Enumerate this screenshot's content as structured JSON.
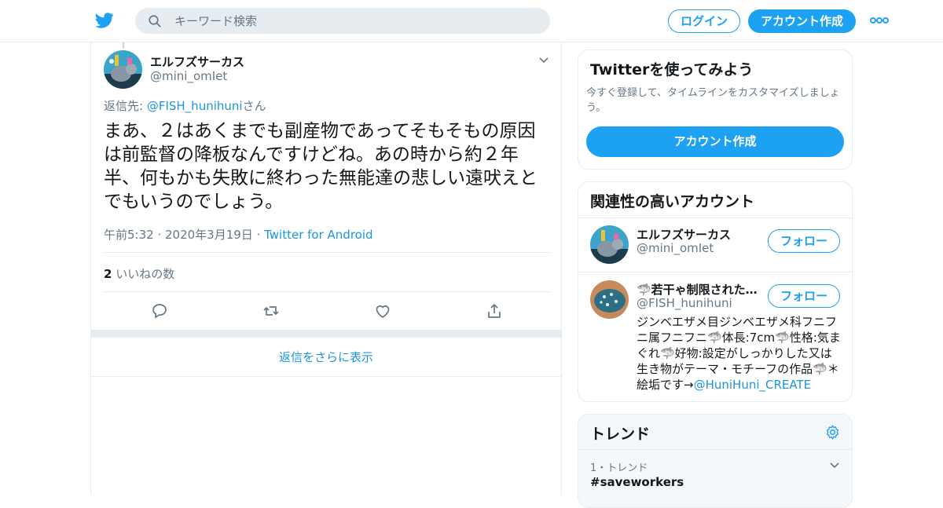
{
  "header": {
    "search_placeholder": "キーワード検索",
    "login_label": "ログイン",
    "signup_label": "アカウント作成"
  },
  "tweet": {
    "author_name": "エルフズサーカス",
    "author_handle": "@mini_omIet",
    "reply_prefix": "返信先: ",
    "reply_handle": "@FISH_hunihuni",
    "reply_suffix": "さん",
    "text": "まあ、２はあくまでも副産物であってそもそもの原因は前監督の降板なんですけどね。あの時から約２年半、何もかも失敗に終わった無能達の悲しい遠吠えとでもいうのでしょう。",
    "timestamp": "午前5:32 · 2020年3月19日",
    "meta_separator": " · ",
    "source": "Twitter for Android",
    "like_count": "2",
    "like_label": "いいねの数",
    "more_replies": "返信をさらに表示"
  },
  "signup_card": {
    "title": "Twitterを使ってみよう",
    "text": "今すぐ登録して、タイムラインをカスタマイズしましょう。",
    "button": "アカウント作成"
  },
  "related": {
    "title": "関連性の高いアカウント",
    "accounts": [
      {
        "name": "エルフズサーカス",
        "handle": "@mini_omIet",
        "follow": "フォロー"
      },
      {
        "name": "🦈若干ゃ制限された…",
        "handle": "@FISH_hunihuni",
        "follow": "フォロー",
        "bio": "ジンベエザメ目ジンベエザメ科フニフニ属フニフニ🦈体長:7cm🦈性格:気まぐれ🦈好物:設定がしっかりした又は生き物がテーマ・モチーフの作品🦈＊絵垢です→",
        "bio_link": "@HuniHuni_CREATE"
      }
    ]
  },
  "trends": {
    "title": "トレンド",
    "items": [
      {
        "meta": "1・トレンド",
        "name": "#saveworkers"
      }
    ]
  },
  "colors": {
    "accent": "#1da1f2",
    "link": "#1b95e0",
    "muted": "#657786",
    "border": "#e6ecf0"
  }
}
